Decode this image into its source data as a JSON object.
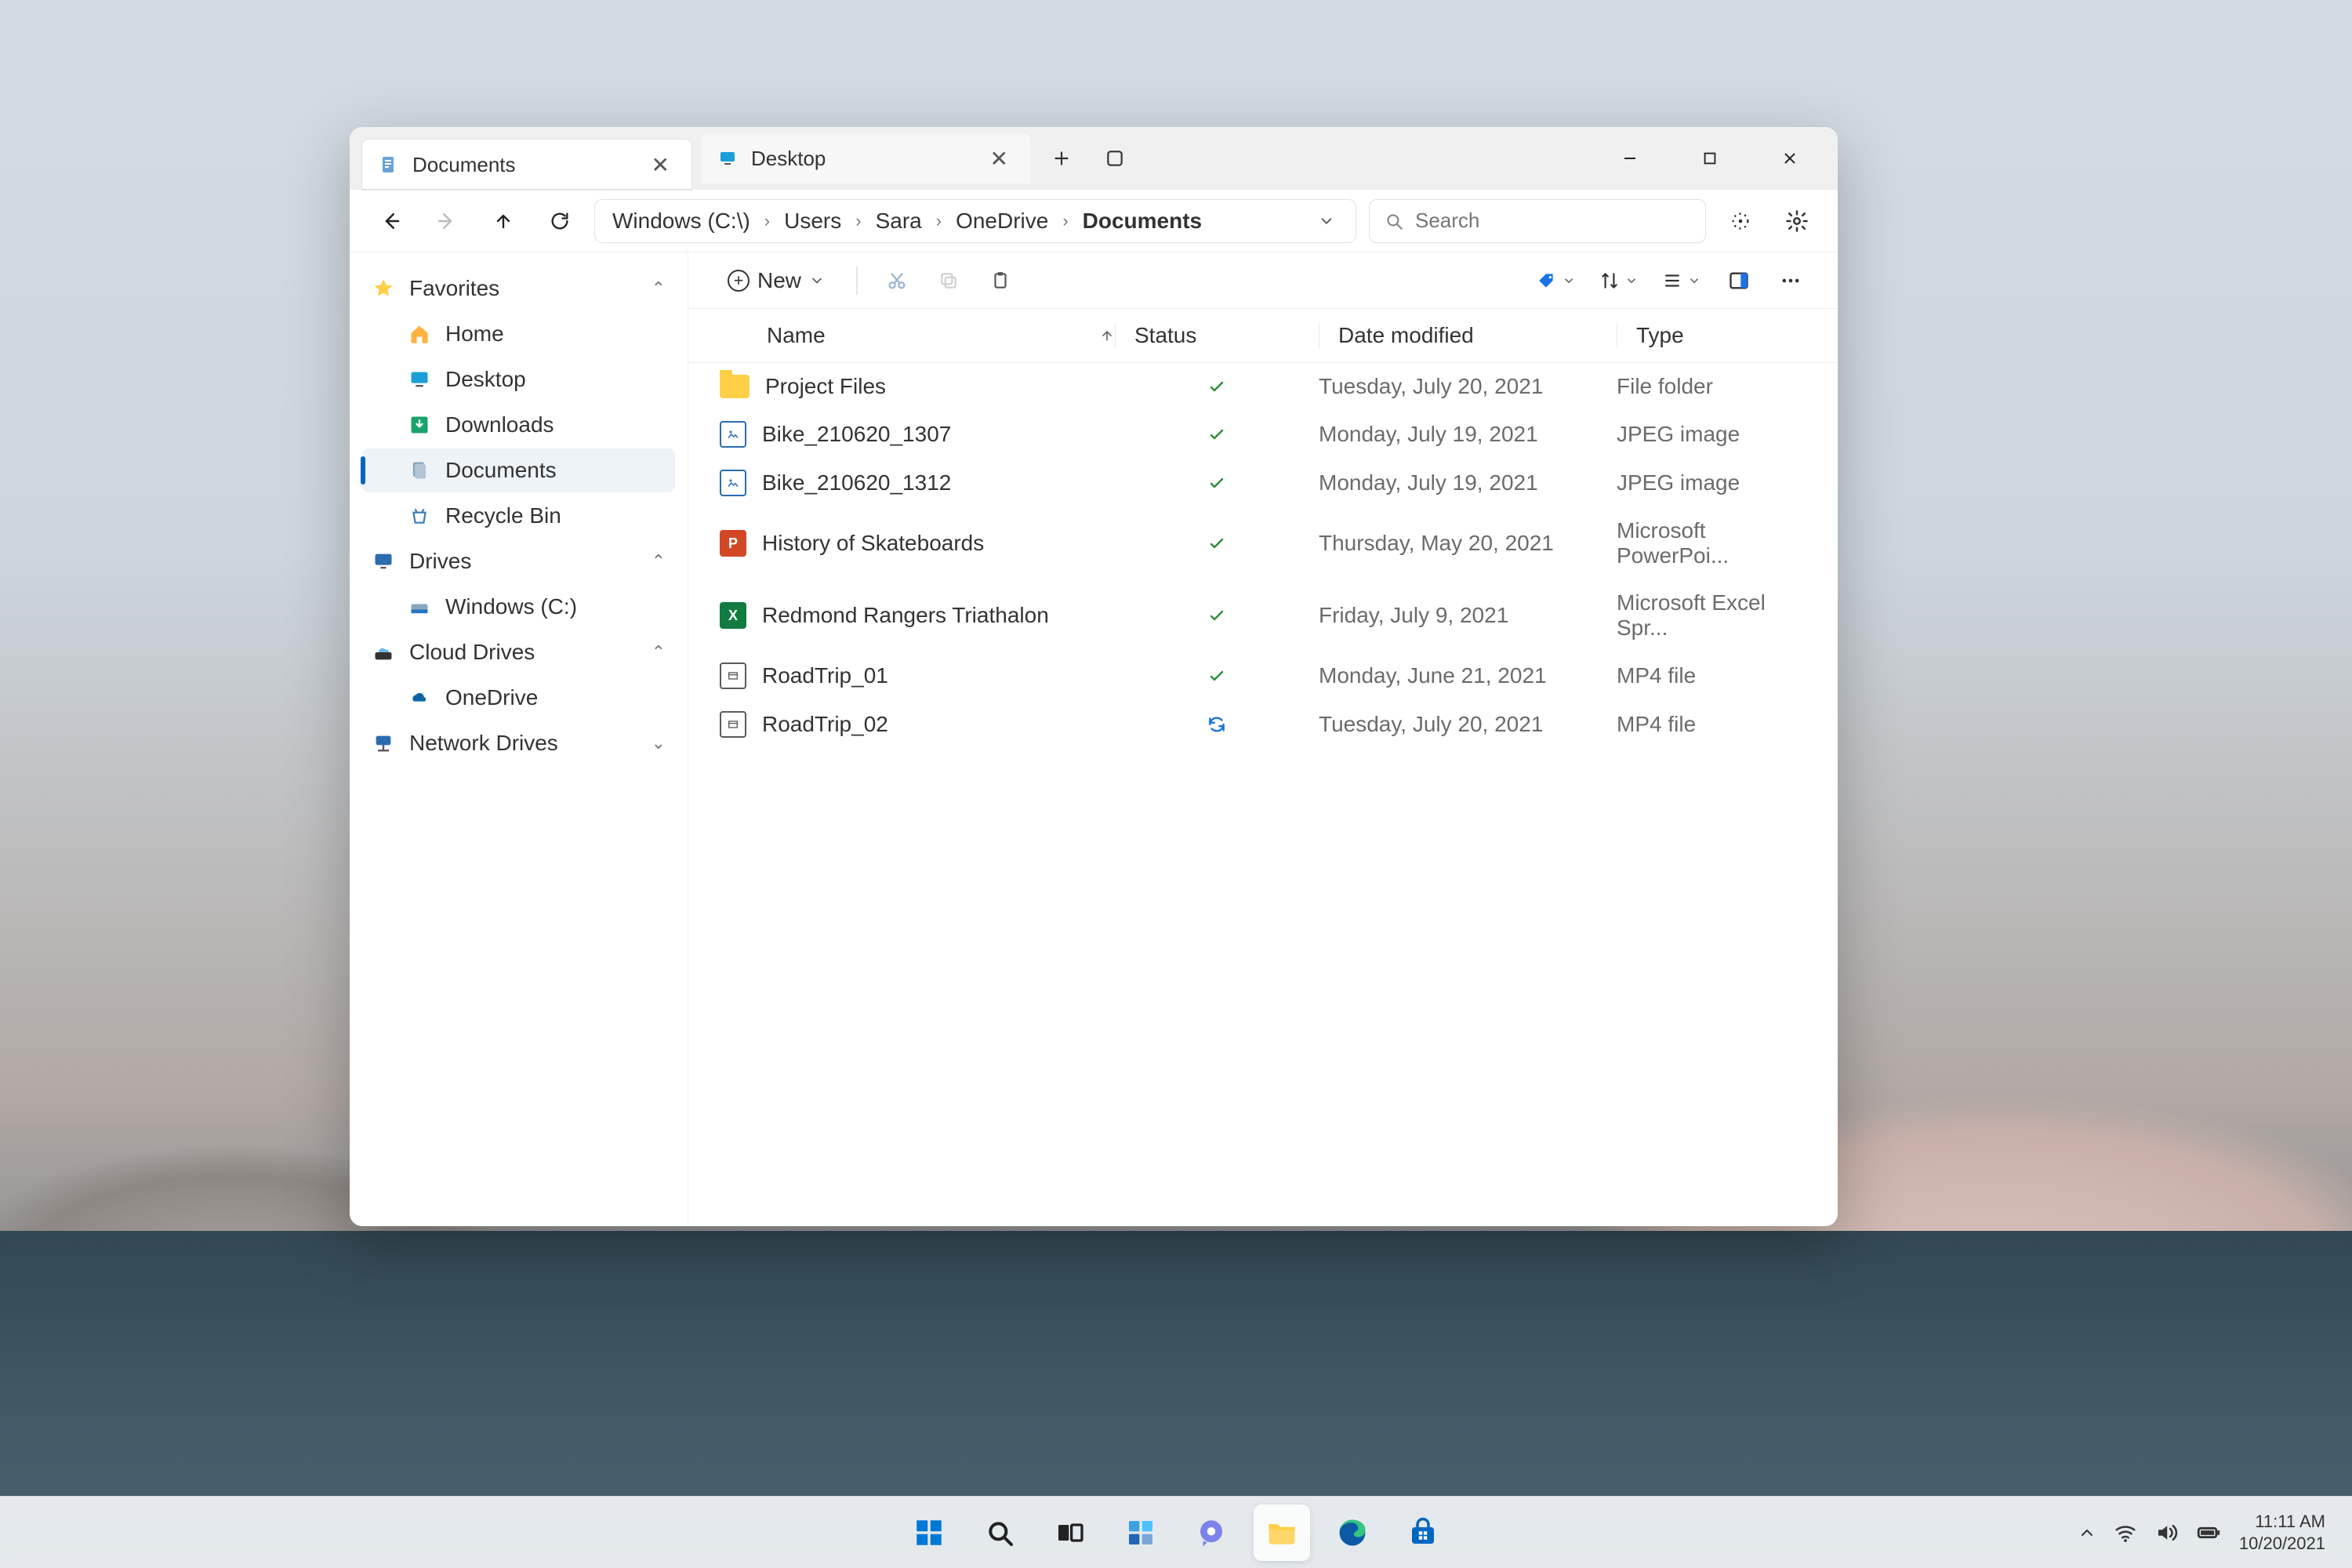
{
  "tabs": [
    {
      "label": "Documents",
      "active": true
    },
    {
      "label": "Desktop",
      "active": false
    }
  ],
  "breadcrumb": [
    "Windows (C:\\)",
    "Users",
    "Sara",
    "OneDrive",
    "Documents"
  ],
  "search": {
    "placeholder": "Search"
  },
  "toolbar": {
    "new_label": "New"
  },
  "sidebar": {
    "groups": [
      {
        "label": "Favorites",
        "icon": "star",
        "expanded": true,
        "items": [
          {
            "label": "Home",
            "icon": "home"
          },
          {
            "label": "Desktop",
            "icon": "desktop"
          },
          {
            "label": "Downloads",
            "icon": "downloads"
          },
          {
            "label": "Documents",
            "icon": "documents",
            "selected": true
          },
          {
            "label": "Recycle Bin",
            "icon": "recycle"
          }
        ]
      },
      {
        "label": "Drives",
        "icon": "monitor",
        "expanded": true,
        "items": [
          {
            "label": "Windows (C:)",
            "icon": "drive"
          }
        ]
      },
      {
        "label": "Cloud Drives",
        "icon": "cloud-drive",
        "expanded": true,
        "items": [
          {
            "label": "OneDrive",
            "icon": "onedrive"
          }
        ]
      },
      {
        "label": "Network Drives",
        "icon": "network",
        "expanded": false,
        "items": []
      }
    ]
  },
  "columns": [
    "Name",
    "Status",
    "Date modified",
    "Type"
  ],
  "files": [
    {
      "name": "Project Files",
      "icon": "folder",
      "status": "ok",
      "date": "Tuesday, July 20, 2021",
      "type": "File folder"
    },
    {
      "name": "Bike_210620_1307",
      "icon": "img",
      "status": "ok",
      "date": "Monday, July 19, 2021",
      "type": "JPEG image"
    },
    {
      "name": "Bike_210620_1312",
      "icon": "img",
      "status": "ok",
      "date": "Monday, July 19, 2021",
      "type": "JPEG image"
    },
    {
      "name": "History of Skateboards",
      "icon": "ppt",
      "status": "ok",
      "date": "Thursday, May 20, 2021",
      "type": "Microsoft PowerPoi..."
    },
    {
      "name": "Redmond Rangers Triathalon",
      "icon": "xls",
      "status": "ok",
      "date": "Friday, July 9, 2021",
      "type": "Microsoft Excel Spr..."
    },
    {
      "name": "RoadTrip_01",
      "icon": "vid",
      "status": "ok",
      "date": "Monday, June 21, 2021",
      "type": "MP4 file"
    },
    {
      "name": "RoadTrip_02",
      "icon": "vid",
      "status": "sync",
      "date": "Tuesday, July 20, 2021",
      "type": "MP4 file"
    }
  ],
  "tray": {
    "time": "11:11 AM",
    "date": "10/20/2021"
  }
}
